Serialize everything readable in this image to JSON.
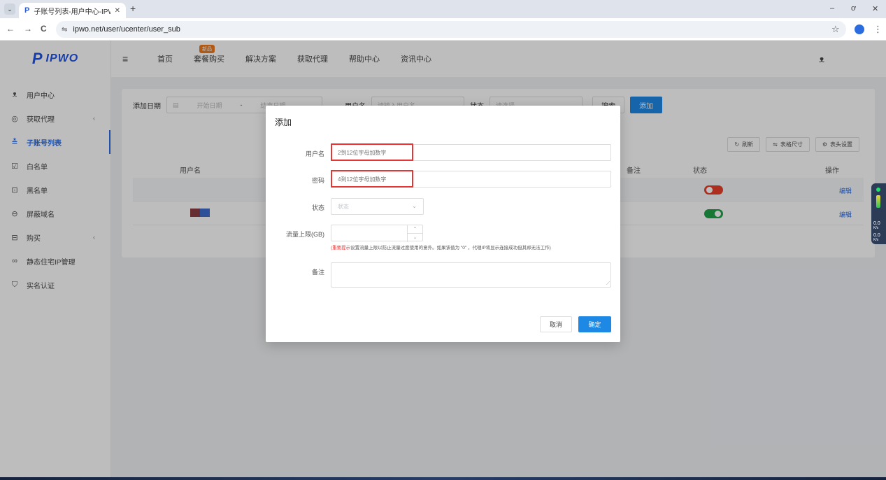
{
  "browser": {
    "tab_title": "子账号列表-用户中心-IPWO全",
    "url": "ipwo.net/user/ucenter/user_sub",
    "tab_menu_glyph": "⌄",
    "close_glyph": "✕",
    "new_tab_glyph": "+",
    "back_glyph": "←",
    "forward_glyph": "→",
    "reload_glyph": "C",
    "site_info_glyph": "⇋",
    "star_glyph": "☆",
    "menu_glyph": "⋮",
    "minimize_glyph": "–",
    "restore_glyph": "ơ",
    "window_close_glyph": "✕"
  },
  "logo": {
    "mark": "P",
    "text": "IPWO"
  },
  "topnav": {
    "items": [
      "首页",
      "套餐购买",
      "解决方案",
      "获取代理",
      "帮助中心",
      "资讯中心"
    ],
    "badge": "新品",
    "menu_glyph": "≡",
    "user_glyph": "ᴥ"
  },
  "sidebar": {
    "items": [
      {
        "label": "用户中心",
        "icon": "user-icon",
        "glyph": "ᴥ"
      },
      {
        "label": "获取代理",
        "icon": "location-icon",
        "glyph": "◎"
      },
      {
        "label": "子账号列表",
        "icon": "sub-account-icon",
        "glyph": "≛"
      },
      {
        "label": "白名单",
        "icon": "whitelist-icon",
        "glyph": "☑"
      },
      {
        "label": "黑名单",
        "icon": "blacklist-icon",
        "glyph": "⊡"
      },
      {
        "label": "屏蔽域名",
        "icon": "block-domain-icon",
        "glyph": "⊖"
      },
      {
        "label": "购买",
        "icon": "purchase-icon",
        "glyph": "⊟"
      },
      {
        "label": "静态住宅IP管理",
        "icon": "infinity-icon",
        "glyph": "∞"
      },
      {
        "label": "实名认证",
        "icon": "shield-check-icon",
        "glyph": "⛉"
      }
    ],
    "chevron_glyph": "‹"
  },
  "filters": {
    "date_label": "添加日期",
    "date_start_placeholder": "开始日期",
    "date_sep": "-",
    "date_end_placeholder": "结束日期",
    "username_label": "用户名",
    "username_placeholder": "请输入用户名",
    "status_label": "状态",
    "status_placeholder": "请选择",
    "search_button": "搜索",
    "add_button": "添加",
    "calendar_glyph": "▤",
    "chevron_glyph": "⌄"
  },
  "toolbar": {
    "refresh": "刷新",
    "table_size": "表格尺寸",
    "column_settings": "表头设置",
    "refresh_glyph": "↻",
    "size_glyph": "⇋",
    "settings_glyph": "⚙"
  },
  "table": {
    "headers": {
      "username": "用户名",
      "note": "备注",
      "status": "状态",
      "actions": "操作"
    },
    "rows": [
      {
        "status": "off",
        "action": "编辑"
      },
      {
        "status": "on",
        "action": "编辑"
      }
    ]
  },
  "net_widget": {
    "up": "0.0",
    "down": "0.0",
    "unit": "K/s"
  },
  "modal": {
    "title": "添加",
    "username_label": "用户名",
    "username_placeholder": "2到12位字母加数字",
    "password_label": "密码",
    "password_placeholder": "4到12位字母加数字",
    "status_label": "状态",
    "status_placeholder": "状态",
    "traffic_label": "流量上限(GB)",
    "hint_warning": "(重要提示",
    "hint_text": "设置流量上限以防止流量过度使用的意外。如果该值为 \"0\" ，代理IP将显示连接成功但其却无法工作)",
    "note_label": "备注",
    "cancel_button": "取消",
    "confirm_button": "确定",
    "chevron_glyph": "⌄",
    "step_up_glyph": "⌃",
    "step_down_glyph": "⌄",
    "resize_glyph": "⟋"
  },
  "colors": {
    "primary": "#1e88e5",
    "brand": "#1f53e8",
    "highlight": "#e63535",
    "toggle_on": "#1fa24a",
    "toggle_off": "#e8402c",
    "badge": "#f07a1a"
  }
}
